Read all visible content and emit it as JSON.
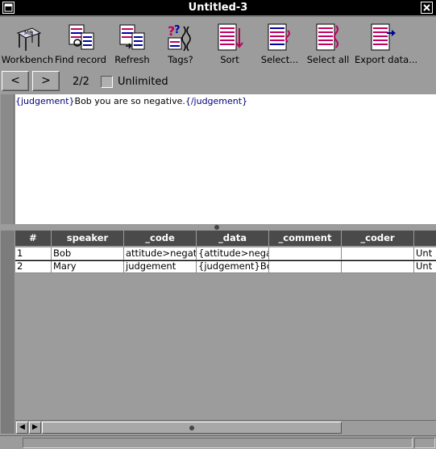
{
  "window": {
    "title": "Untitled-3",
    "menu_icon": "window-menu-icon",
    "close_icon": "close-icon"
  },
  "toolbar": {
    "items": [
      {
        "label": "Workbench",
        "icon": "workbench-icon"
      },
      {
        "label": "Find record",
        "icon": "find-record-icon"
      },
      {
        "label": "Refresh",
        "icon": "refresh-icon"
      },
      {
        "label": "Tags?",
        "icon": "tags-icon"
      },
      {
        "label": "Sort",
        "icon": "sort-icon"
      },
      {
        "label": "Select...",
        "icon": "select-icon"
      },
      {
        "label": "Select all",
        "icon": "select-all-icon"
      },
      {
        "label": "Export data...",
        "icon": "export-data-icon"
      }
    ]
  },
  "nav": {
    "prev_label": "<",
    "next_label": ">",
    "counter": "2/2",
    "unlimited_label": "Unlimited",
    "unlimited_checked": false
  },
  "editor": {
    "tag_open": "{judgement}",
    "body": "Bob you are so negative.",
    "tag_close": "{/judgement}"
  },
  "table": {
    "columns": [
      "#",
      "speaker",
      "_code",
      "_data",
      "_comment",
      "_coder",
      ""
    ],
    "rows": [
      [
        "1",
        "Bob",
        "attitude>negati",
        "{attitude>negat",
        "",
        "",
        "Unt"
      ],
      [
        "2",
        "Mary",
        "judgement",
        "{judgement}Bo",
        "",
        "",
        "Unt"
      ]
    ]
  },
  "scroll": {
    "left_arrow": "◀",
    "right_arrow": "▶"
  },
  "colors": {
    "titlebar": "#000000",
    "chrome": "#9c9c9c",
    "header": "#4a4a4a",
    "tag_text": "#00007a"
  }
}
